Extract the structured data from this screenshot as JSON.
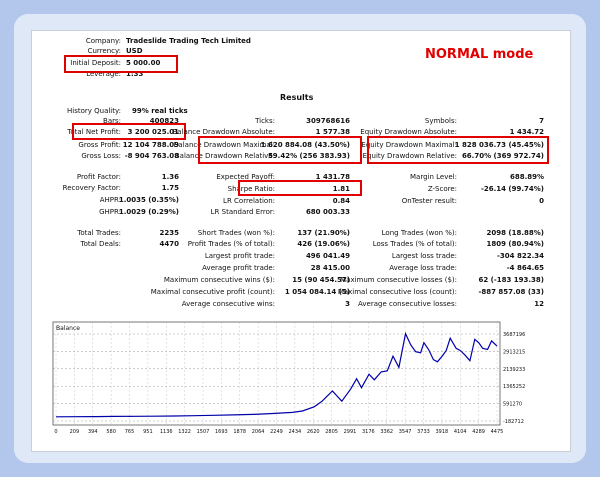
{
  "mode_label": "NORMAL mode",
  "header": {
    "company_label": "Company:",
    "company_value": "Tradeslide Trading Tech Limited",
    "currency_label": "Currency:",
    "currency_value": "USD",
    "deposit_label": "Initial Deposit:",
    "deposit_value": "5 000.00",
    "leverage_label": "Leverage:",
    "leverage_value": "1:33"
  },
  "results_title": "Results",
  "rows": {
    "history_quality": {
      "label": "History Quality:",
      "value": "99% real ticks"
    },
    "bars": {
      "label": "Bars:",
      "value": "400823"
    },
    "total_net_profit": {
      "label": "Total Net Profit:",
      "value": "3 200 025.01"
    },
    "gross_profit": {
      "label": "Gross Profit:",
      "value": "12 104 788.09"
    },
    "gross_loss": {
      "label": "Gross Loss:",
      "value": "-8 904 763.08"
    },
    "profit_factor": {
      "label": "Profit Factor:",
      "value": "1.36"
    },
    "recovery_factor": {
      "label": "Recovery Factor:",
      "value": "1.75"
    },
    "ahpr": {
      "label": "AHPR:",
      "value": "1.0035 (0.35%)"
    },
    "ghpr": {
      "label": "GHPR:",
      "value": "1.0029 (0.29%)"
    },
    "total_trades": {
      "label": "Total Trades:",
      "value": "2235"
    },
    "total_deals": {
      "label": "Total Deals:",
      "value": "4470"
    },
    "ticks": {
      "label": "Ticks:",
      "value": "309768616"
    },
    "balance_dd_abs": {
      "label": "Balance Drawdown Absolute:",
      "value": "1 577.38"
    },
    "balance_dd_max": {
      "label": "Balance Drawdown Maximal:",
      "value": "1 620 884.08 (43.50%)"
    },
    "balance_dd_rel": {
      "label": "Balance Drawdown Relative:",
      "value": "59.42% (256 383.93)"
    },
    "expected_payoff": {
      "label": "Expected Payoff:",
      "value": "1 431.78"
    },
    "sharpe_ratio": {
      "label": "Sharpe Ratio:",
      "value": "1.81"
    },
    "lr_correlation": {
      "label": "LR Correlation:",
      "value": "0.84"
    },
    "lr_std_error": {
      "label": "LR Standard Error:",
      "value": "680 003.33"
    },
    "short_trades": {
      "label": "Short Trades (won %):",
      "value": "137 (21.90%)"
    },
    "profit_trades": {
      "label": "Profit Trades (% of total):",
      "value": "426 (19.06%)"
    },
    "largest_profit": {
      "label": "Largest profit trade:",
      "value": "496 041.49"
    },
    "average_profit": {
      "label": "Average profit trade:",
      "value": "28 415.00"
    },
    "max_consec_wins": {
      "label": "Maximum consecutive wins ($):",
      "value": "15 (90 454.57)"
    },
    "maximal_consec_profit": {
      "label": "Maximal consecutive profit (count):",
      "value": "1 054 084.14 (5)"
    },
    "avg_consec_wins": {
      "label": "Average consecutive wins:",
      "value": "3"
    },
    "symbols": {
      "label": "Symbols:",
      "value": "7"
    },
    "equity_dd_abs": {
      "label": "Equity Drawdown Absolute:",
      "value": "1 434.72"
    },
    "equity_dd_max": {
      "label": "Equity Drawdown Maximal:",
      "value": "1 828 036.73 (45.45%)"
    },
    "equity_dd_rel": {
      "label": "Equity Drawdown Relative:",
      "value": "66.70% (369 972.74)"
    },
    "margin_level": {
      "label": "Margin Level:",
      "value": "688.89%"
    },
    "z_score": {
      "label": "Z-Score:",
      "value": "-26.14 (99.74%)"
    },
    "ontester": {
      "label": "OnTester result:",
      "value": "0"
    },
    "long_trades": {
      "label": "Long Trades (won %):",
      "value": "2098 (18.88%)"
    },
    "loss_trades": {
      "label": "Loss Trades (% of total):",
      "value": "1809 (80.94%)"
    },
    "largest_loss": {
      "label": "Largest loss trade:",
      "value": "-304 822.34"
    },
    "average_loss": {
      "label": "Average loss trade:",
      "value": "-4 864.65"
    },
    "max_consec_losses": {
      "label": "Maximum consecutive losses ($):",
      "value": "62 (-183 193.38)"
    },
    "maximal_consec_loss": {
      "label": "Maximal consecutive loss (count):",
      "value": "-887 857.08 (33)"
    },
    "avg_consec_losses": {
      "label": "Average consecutive losses:",
      "value": "12"
    }
  },
  "chart_data": {
    "type": "line",
    "title": "Balance",
    "x_ticks": [
      "0",
      "209",
      "394",
      "580",
      "765",
      "951",
      "1136",
      "1322",
      "1507",
      "1693",
      "1878",
      "2064",
      "2249",
      "2434",
      "2620",
      "2805",
      "2991",
      "3176",
      "3362",
      "3547",
      "3733",
      "3918",
      "4104",
      "4289",
      "4475"
    ],
    "y_ticks": [
      "3687196",
      "2913215",
      "2139233",
      "1365252",
      "591270",
      "-182712"
    ],
    "ylim": [
      -182712,
      3687196
    ],
    "xlim": [
      0,
      4475
    ],
    "line_color": "#0000aa",
    "series": [
      {
        "x": [
          0,
          200,
          400,
          600,
          800,
          1000,
          1200,
          1400,
          1600,
          1800,
          2000,
          2200,
          2400,
          2500,
          2620,
          2700,
          2805,
          2900,
          2991,
          3050,
          3100,
          3176,
          3230,
          3300,
          3362,
          3420,
          3480,
          3547,
          3600,
          3650,
          3700,
          3733,
          3780,
          3830,
          3870,
          3918,
          3960,
          4000,
          4060,
          4104,
          4150,
          4200,
          4250,
          4289,
          4330,
          4380,
          4420,
          4475
        ],
        "y": [
          5000,
          10000,
          15000,
          20000,
          25000,
          30000,
          40000,
          55000,
          70000,
          90000,
          110000,
          150000,
          200000,
          260000,
          450000,
          700000,
          1150000,
          700000,
          1250000,
          1700000,
          1300000,
          1900000,
          1650000,
          2000000,
          2050000,
          2700000,
          2200000,
          3700000,
          3200000,
          2900000,
          2850000,
          3300000,
          3000000,
          2550000,
          2450000,
          2700000,
          2950000,
          3500000,
          3050000,
          2950000,
          2750000,
          2500000,
          3450000,
          3300000,
          3050000,
          3000000,
          3380000,
          3150000
        ]
      }
    ]
  }
}
